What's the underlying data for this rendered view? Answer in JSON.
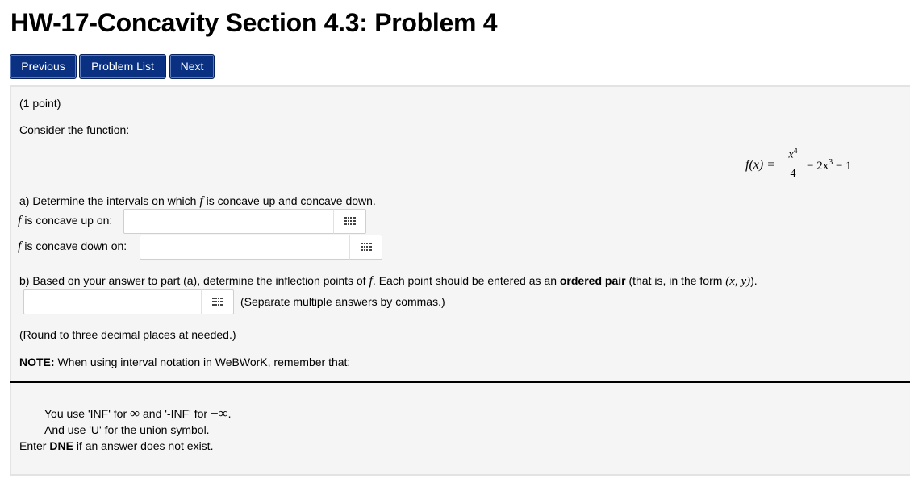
{
  "page": {
    "title": "HW-17-Concavity Section 4.3: Problem 4"
  },
  "nav": {
    "previous": "Previous",
    "problem_list": "Problem List",
    "next": "Next"
  },
  "problem": {
    "points": "(1 point)",
    "intro": "Consider the function:",
    "function": {
      "lhs": "f(x) =",
      "num": "x",
      "num_exp": "4",
      "den": "4",
      "rest_a": "− 2x",
      "rest_exp": "3",
      "rest_b": "− 1"
    },
    "part_a": {
      "prompt_pre": "a) Determine the intervals on which",
      "prompt_f": "f",
      "prompt_post": "is concave up and concave down.",
      "up_f": "f",
      "up_label": "is concave up on:",
      "up_value": "",
      "down_f": "f",
      "down_label": "is concave down on:",
      "down_value": ""
    },
    "part_b": {
      "prompt_pre": "b) Based on your answer to part (a), determine the inflection points of",
      "prompt_f": "f",
      "prompt_mid": ". Each point should be entered as an",
      "prompt_bold": "ordered pair",
      "prompt_post": "(that is, in the form",
      "prompt_math": "(x, y)",
      "prompt_end": ").",
      "value": "",
      "hint": "(Separate multiple answers by commas.)"
    },
    "round_note": "(Round to three decimal places at needed.)",
    "note_bold": "NOTE:",
    "note_text": "When using interval notation in WeBWorK, remember that:",
    "tip1_pre": "You use 'INF' for",
    "tip1_inf": "∞",
    "tip1_mid": "and '-INF' for",
    "tip1_neginf": "−∞",
    "tip1_end": ".",
    "tip2": "And use 'U' for the union symbol.",
    "dne_pre": "Enter",
    "dne_bold": "DNE",
    "dne_post": "if an answer does not exist."
  },
  "icons": {
    "palette": "grid-icon"
  }
}
